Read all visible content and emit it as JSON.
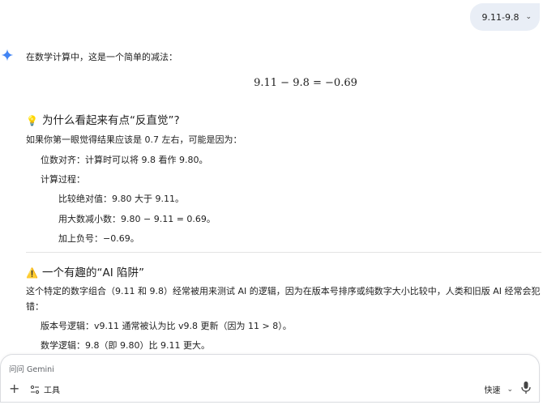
{
  "user_query": {
    "text": "9.11-9.8"
  },
  "answer": {
    "intro": "在数学计算中，这是一个简单的减法：",
    "formula": "9.11 − 9.8 = −0.69",
    "section1": {
      "emoji": "💡",
      "title": "为什么看起来有点“反直觉”?",
      "lead": "如果你第一眼觉得结果应该是 0.7 左右，可能是因为：",
      "item1": "位数对齐：计算时可以将 9.8 看作 9.80。",
      "item2": "计算过程：",
      "sub1": "比较绝对值：9.80 大于 9.11。",
      "sub2": "用大数减小数：9.80 − 9.11 = 0.69。",
      "sub3": "加上负号：−0.69。"
    },
    "section2": {
      "emoji": "⚠️",
      "title": "一个有趣的“AI 陷阱”",
      "lead_line1": "这个特定的数字组合（9.11 和 9.8）经常被用来测试 AI 的逻辑，因为在版本号排序或纯数字大小比较中，人类和旧版 AI 经常会犯",
      "lead_line2": "错：",
      "item1": "版本号逻辑：v9.11 通常被认为比 v9.8 更新（因为 11 > 8）。",
      "item2": "数学逻辑：9.8（即 9.80）比 9.11 更大。"
    }
  },
  "composer": {
    "placeholder": "问问 Gemini",
    "tools_label": "工具",
    "speed_label": "快速"
  },
  "colors": {
    "chip_bg": "#e9eef6",
    "gemini_blue": "#4285f4",
    "text": "#1f1f1f"
  },
  "icons": [
    "gemini-star-icon",
    "chevron-down-icon",
    "plus-icon",
    "tools-icon",
    "mic-icon",
    "lightbulb-icon",
    "warning-icon"
  ]
}
